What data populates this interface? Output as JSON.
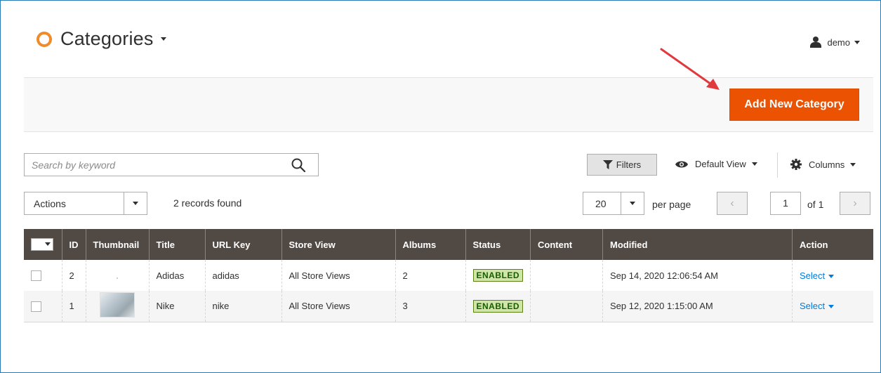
{
  "header": {
    "title": "Categories",
    "user": "demo"
  },
  "actions": {
    "add_button": "Add New Category"
  },
  "toolbar": {
    "search_placeholder": "Search by keyword",
    "filters_label": "Filters",
    "view_label": "Default View",
    "columns_label": "Columns",
    "mass_actions_label": "Actions",
    "records_found": "2 records found",
    "per_page_value": "20",
    "per_page_label": "per page",
    "current_page": "1",
    "total_pages_label": "of 1"
  },
  "grid": {
    "columns": [
      "ID",
      "Thumbnail",
      "Title",
      "URL Key",
      "Store View",
      "Albums",
      "Status",
      "Content",
      "Modified",
      "Action"
    ],
    "rows": [
      {
        "id": "2",
        "title": "Adidas",
        "url_key": "adidas",
        "store_view": "All Store Views",
        "albums": "2",
        "status": "ENABLED",
        "content": "",
        "modified": "Sep 14, 2020 12:06:54 AM",
        "action": "Select"
      },
      {
        "id": "1",
        "title": "Nike",
        "url_key": "nike",
        "store_view": "All Store Views",
        "albums": "3",
        "status": "ENABLED",
        "content": "",
        "modified": "Sep 12, 2020 1:15:00 AM",
        "action": "Select"
      }
    ]
  },
  "colors": {
    "accent": "#eb5202",
    "grid_header": "#514943",
    "link": "#007bdb",
    "status_bg": "#d0e5a9",
    "logo": "#f08b2a"
  }
}
